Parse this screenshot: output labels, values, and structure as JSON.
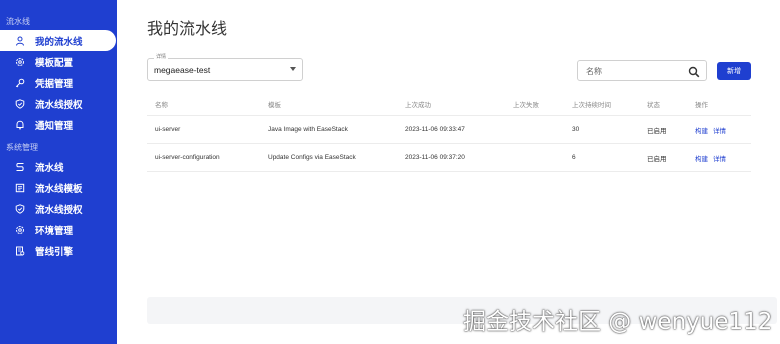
{
  "sidebar": {
    "section1_label": "流水线",
    "section1_items": [
      {
        "label": "我的流水线",
        "icon": "user-icon"
      },
      {
        "label": "模板配置",
        "icon": "gear-icon"
      },
      {
        "label": "凭据管理",
        "icon": "key-icon"
      },
      {
        "label": "流水线授权",
        "icon": "shield-icon"
      },
      {
        "label": "通知管理",
        "icon": "bell-icon"
      }
    ],
    "section2_label": "系统管理",
    "section2_items": [
      {
        "label": "流水线",
        "icon": "pipeline-icon"
      },
      {
        "label": "流水线模板",
        "icon": "template-icon"
      },
      {
        "label": "流水线授权",
        "icon": "shield-icon"
      },
      {
        "label": "环境管理",
        "icon": "gear-icon"
      },
      {
        "label": "管线引擎",
        "icon": "engine-icon"
      }
    ]
  },
  "main": {
    "title": "我的流水线",
    "select_label": "详情",
    "select_value": "megaease-test",
    "search_placeholder": "名称",
    "add_button": "新增",
    "table": {
      "headers": [
        "名称",
        "模板",
        "上次成功",
        "上次失败",
        "上次持续时间",
        "状态",
        "操作"
      ],
      "rows": [
        {
          "name": "ui-server",
          "template": "Java Image with EaseStack",
          "last_success": "2023-11-06 09:33:47",
          "last_failure": "",
          "duration": "30",
          "status": "已启用",
          "action_build": "构建",
          "action_detail": "详情"
        },
        {
          "name": "ui-server-configuration",
          "template": "Update Configs via EaseStack",
          "last_success": "2023-11-06 09:37:20",
          "last_failure": "",
          "duration": "6",
          "status": "已启用",
          "action_build": "构建",
          "action_detail": "详情"
        }
      ]
    }
  },
  "watermark": "掘金技术社区 @ wenyue112",
  "colors": {
    "brand": "#1f3fd0",
    "sidebar_bg": "#1f3fd0"
  }
}
